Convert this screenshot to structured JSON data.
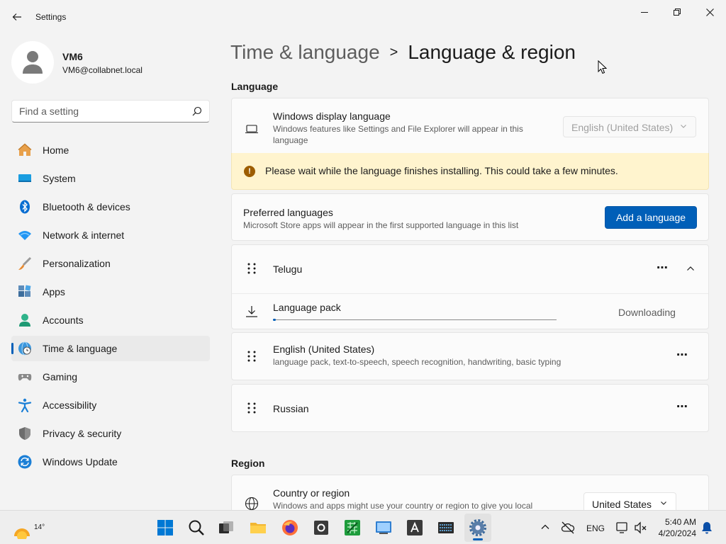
{
  "window": {
    "title": "Settings"
  },
  "profile": {
    "name": "VM6",
    "email": "VM6@collabnet.local"
  },
  "search": {
    "placeholder": "Find a setting"
  },
  "sidebar": {
    "items": [
      {
        "label": "Home",
        "icon": "home-icon"
      },
      {
        "label": "System",
        "icon": "system-icon"
      },
      {
        "label": "Bluetooth & devices",
        "icon": "bluetooth-icon"
      },
      {
        "label": "Network & internet",
        "icon": "wifi-icon"
      },
      {
        "label": "Personalization",
        "icon": "brush-icon"
      },
      {
        "label": "Apps",
        "icon": "apps-icon"
      },
      {
        "label": "Accounts",
        "icon": "accounts-icon"
      },
      {
        "label": "Time & language",
        "icon": "globe-clock-icon",
        "active": true
      },
      {
        "label": "Gaming",
        "icon": "gamepad-icon"
      },
      {
        "label": "Accessibility",
        "icon": "accessibility-icon"
      },
      {
        "label": "Privacy & security",
        "icon": "shield-icon"
      },
      {
        "label": "Windows Update",
        "icon": "update-icon"
      }
    ]
  },
  "breadcrumb": {
    "parent": "Time & language",
    "separator": ">",
    "current": "Language & region"
  },
  "language_section": {
    "title": "Language",
    "display_language": {
      "title": "Windows display language",
      "description": "Windows features like Settings and File Explorer will appear in this language",
      "value": "English (United States)"
    },
    "warning": {
      "icon": "!",
      "text": "Please wait while the language finishes installing. This could take a few minutes."
    },
    "preferred": {
      "title": "Preferred languages",
      "description": "Microsoft Store apps will appear in the first supported language in this list",
      "add_button": "Add a language"
    },
    "languages": [
      {
        "name": "Telugu",
        "more": "⋯",
        "expanded": true,
        "pack": {
          "title": "Language pack",
          "status": "Downloading",
          "progress": 0.01
        }
      },
      {
        "name": "English (United States)",
        "description": "language pack, text-to-speech, speech recognition, handwriting, basic typing",
        "more": "⋯"
      },
      {
        "name": "Russian",
        "more": "⋯"
      }
    ]
  },
  "region_section": {
    "title": "Region",
    "country": {
      "title": "Country or region",
      "description": "Windows and apps might use your country or region to give you local",
      "value": "United States"
    }
  },
  "taskbar": {
    "weather_temp": "14°",
    "language": "ENG",
    "time": "5:40 AM",
    "date": "4/20/2024",
    "colors": {
      "accent": "#005fb8",
      "start_blue": "#0078d4"
    }
  }
}
